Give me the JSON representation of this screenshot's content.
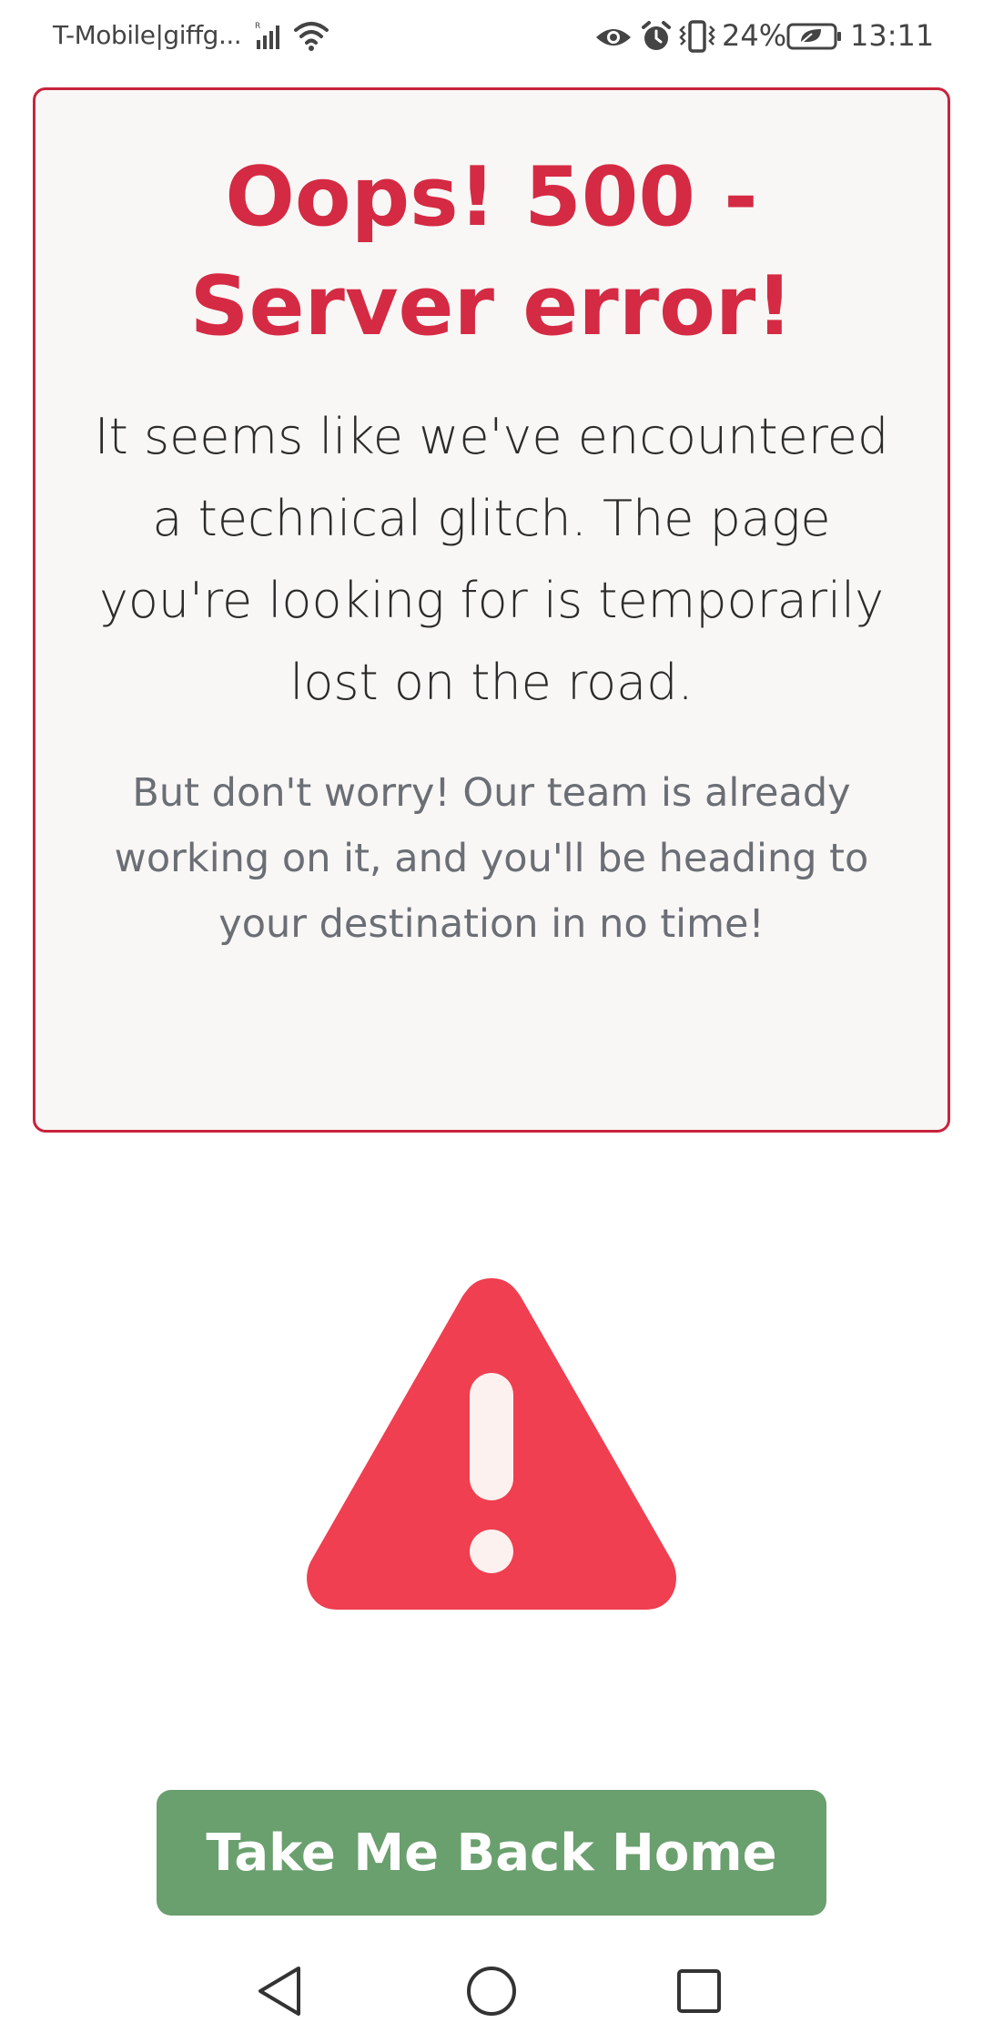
{
  "status_bar": {
    "carrier": "T-Mobile|giffg...",
    "battery_percent": "24%",
    "time": "13:11",
    "icons": [
      "signal-icon",
      "wifi-icon",
      "eye-icon",
      "alarm-icon",
      "vibrate-icon",
      "battery-icon"
    ]
  },
  "error": {
    "title": "Oops! 500 - Server error!",
    "message": "It seems like we've encountered a technical glitch. The page you're looking for is temporarily lost on the road.",
    "reassurance": "But don't worry! Our team is already working on it, and you'll be heading to your destination in no time!"
  },
  "warning": {
    "icon": "warning-triangle-icon"
  },
  "actions": {
    "home_label": "Take Me Back Home"
  },
  "nav_bar": {
    "icons": [
      "back-icon",
      "home-icon",
      "recent-apps-icon"
    ]
  },
  "colors": {
    "accent_red": "#d52a43",
    "card_border": "#c8233c",
    "card_background": "#f8f7f5",
    "warning_red": "#ef3f50",
    "button_green": "#6a9f6e",
    "muted_text": "#6b6e75"
  }
}
